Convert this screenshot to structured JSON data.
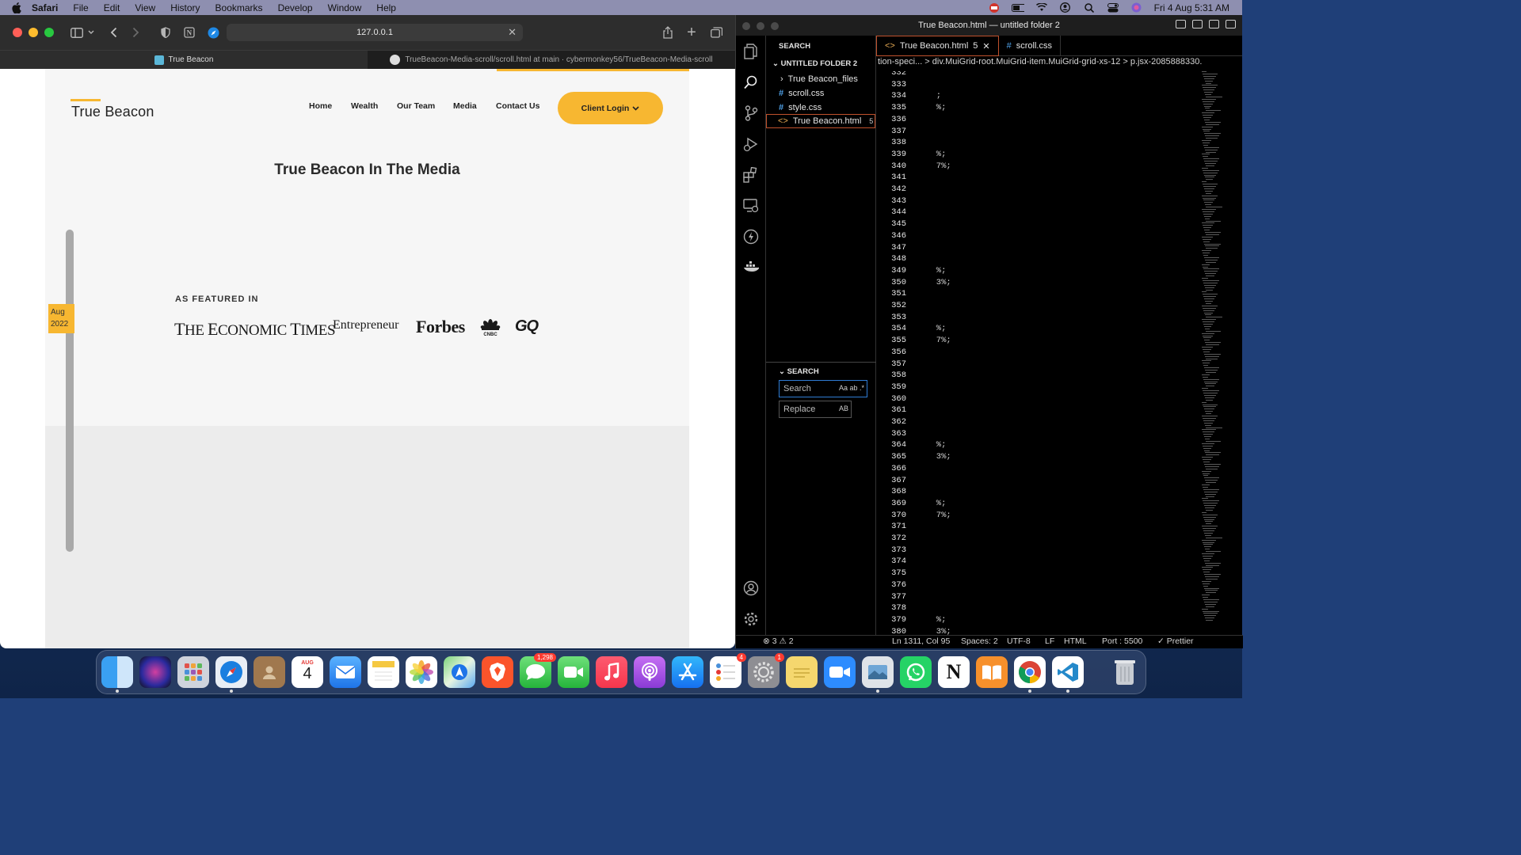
{
  "menubar": {
    "app": "Safari",
    "items": [
      "File",
      "Edit",
      "View",
      "History",
      "Bookmarks",
      "Develop",
      "Window",
      "Help"
    ],
    "clock": "Fri 4 Aug  5:31 AM"
  },
  "safari": {
    "address": "127.0.0.1",
    "tabs": [
      {
        "label": "True Beacon"
      },
      {
        "label": "TrueBeacon-Media-scroll/scroll.html at main · cybermonkey56/TrueBeacon-Media-scroll"
      }
    ]
  },
  "site": {
    "logo": "True Beacon",
    "nav": [
      "Home",
      "Wealth",
      "Our Team",
      "Media",
      "Contact Us"
    ],
    "login": "Client Login",
    "title": "True Beacon In The Media",
    "date_month": "Aug",
    "date_year": "2022",
    "featured_label": "AS FEATURED IN",
    "brands": [
      "THE ECONOMIC TIMES",
      "Entrepreneur",
      "Forbes",
      "CNBC",
      "GQ"
    ]
  },
  "vscode": {
    "title": "True Beacon.html — untitled folder 2",
    "explorer_heading": "SEARCH",
    "folder": "UNTITLED FOLDER 2",
    "files": [
      {
        "name": "True Beacon_files",
        "type": "folder"
      },
      {
        "name": "scroll.css",
        "type": "css"
      },
      {
        "name": "style.css",
        "type": "css"
      },
      {
        "name": "True Beacon.html",
        "type": "html",
        "badge": "5"
      }
    ],
    "search_heading": "SEARCH",
    "search_placeholder": "Search",
    "search_opts": "Aa  ab  .*",
    "replace_placeholder": "Replace",
    "replace_opts": "AB",
    "tabs": [
      {
        "label": "True Beacon.html",
        "badge": "5"
      },
      {
        "label": "scroll.css"
      }
    ],
    "breadcrumb": "tion-speci...  >  div.MuiGrid-root.MuiGrid-item.MuiGrid-grid-xs-12  >  p.jsx-2085888330.",
    "lines": [
      {
        "n": "332",
        "t": ""
      },
      {
        "n": "333",
        "t": ""
      },
      {
        "n": "334",
        "t": ";"
      },
      {
        "n": "335",
        "t": "%;"
      },
      {
        "n": "336",
        "t": ""
      },
      {
        "n": "337",
        "t": ""
      },
      {
        "n": "338",
        "t": ""
      },
      {
        "n": "339",
        "t": "%;"
      },
      {
        "n": "340",
        "t": "7%;"
      },
      {
        "n": "341",
        "t": ""
      },
      {
        "n": "342",
        "t": ""
      },
      {
        "n": "343",
        "t": ""
      },
      {
        "n": "344",
        "t": ""
      },
      {
        "n": "345",
        "t": ""
      },
      {
        "n": "346",
        "t": ""
      },
      {
        "n": "347",
        "t": ""
      },
      {
        "n": "348",
        "t": ""
      },
      {
        "n": "349",
        "t": "%;"
      },
      {
        "n": "350",
        "t": "3%;"
      },
      {
        "n": "351",
        "t": ""
      },
      {
        "n": "352",
        "t": ""
      },
      {
        "n": "353",
        "t": ""
      },
      {
        "n": "354",
        "t": "%;"
      },
      {
        "n": "355",
        "t": "7%;"
      },
      {
        "n": "356",
        "t": ""
      },
      {
        "n": "357",
        "t": ""
      },
      {
        "n": "358",
        "t": ""
      },
      {
        "n": "359",
        "t": ""
      },
      {
        "n": "360",
        "t": ""
      },
      {
        "n": "361",
        "t": ""
      },
      {
        "n": "362",
        "t": ""
      },
      {
        "n": "363",
        "t": ""
      },
      {
        "n": "364",
        "t": "%;"
      },
      {
        "n": "365",
        "t": "3%;"
      },
      {
        "n": "366",
        "t": ""
      },
      {
        "n": "367",
        "t": ""
      },
      {
        "n": "368",
        "t": ""
      },
      {
        "n": "369",
        "t": "%;"
      },
      {
        "n": "370",
        "t": "7%;"
      },
      {
        "n": "371",
        "t": ""
      },
      {
        "n": "372",
        "t": ""
      },
      {
        "n": "373",
        "t": ""
      },
      {
        "n": "374",
        "t": ""
      },
      {
        "n": "375",
        "t": ""
      },
      {
        "n": "376",
        "t": ""
      },
      {
        "n": "377",
        "t": ""
      },
      {
        "n": "378",
        "t": ""
      },
      {
        "n": "379",
        "t": "%;"
      },
      {
        "n": "380",
        "t": "3%;"
      }
    ],
    "status": {
      "problems": "⊗ 3 ⚠ 2",
      "position": "Ln 1311, Col 95",
      "spaces": "Spaces: 2",
      "encoding": "UTF-8",
      "eol": "LF",
      "language": "HTML",
      "port": "Port : 5500",
      "prettier": "✓ Prettier"
    }
  },
  "dock": {
    "calendar_month": "AUG",
    "calendar_day": "4",
    "messages_badge": "1,298",
    "reminders_badge": "4",
    "settings_badge": "1"
  },
  "colors": {
    "accent": "#f7b731",
    "vscode_bg": "#000000",
    "active_tab_border": "#c0512c"
  }
}
